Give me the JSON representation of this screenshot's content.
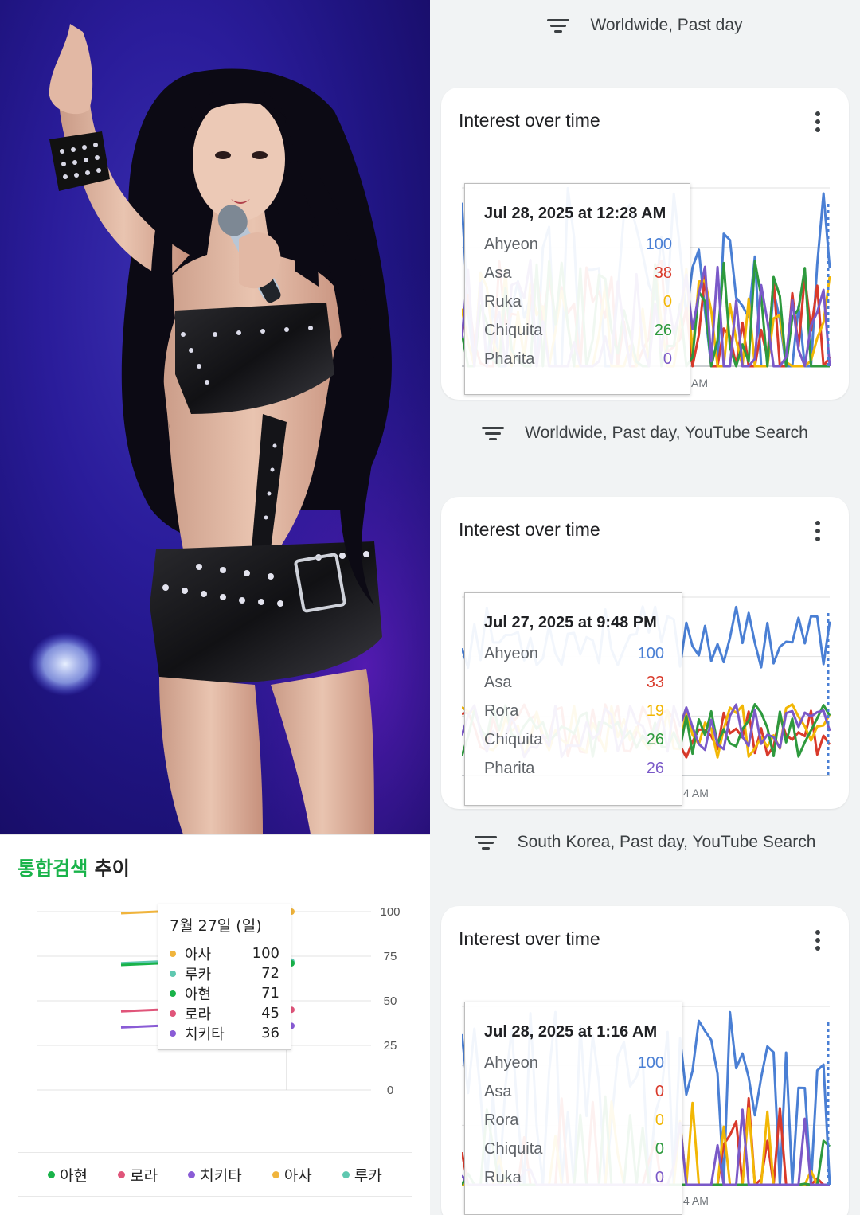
{
  "photo": {
    "description_icon": "performer-photo"
  },
  "korean_chart": {
    "title_green": "통합검색",
    "title_rest": " 추이",
    "y_ticks": [
      "100",
      "75",
      "50",
      "25",
      "0"
    ],
    "tooltip": {
      "date": "7월 27일 (일)",
      "rows": [
        {
          "name": "아사",
          "value": "100",
          "color": "#f0b43c"
        },
        {
          "name": "루카",
          "value": "72",
          "color": "#5fc8b0"
        },
        {
          "name": "아현",
          "value": "71",
          "color": "#19b34a"
        },
        {
          "name": "로라",
          "value": "45",
          "color": "#e0557a"
        },
        {
          "name": "치키타",
          "value": "36",
          "color": "#8a5cd6"
        }
      ]
    },
    "legend": [
      {
        "name": "아현",
        "color": "#19b34a"
      },
      {
        "name": "로라",
        "color": "#e0557a"
      },
      {
        "name": "치키타",
        "color": "#8a5cd6"
      },
      {
        "name": "아사",
        "color": "#f0b43c"
      },
      {
        "name": "루카",
        "color": "#5fc8b0"
      }
    ]
  },
  "chart_data": [
    {
      "type": "line",
      "title": "통합검색 추이",
      "series": [
        {
          "name": "아사",
          "values": [
            100
          ]
        },
        {
          "name": "루카",
          "values": [
            72
          ]
        },
        {
          "name": "아현",
          "values": [
            71
          ]
        },
        {
          "name": "로라",
          "values": [
            45
          ]
        },
        {
          "name": "치키타",
          "values": [
            36
          ]
        }
      ],
      "ylim": [
        0,
        100
      ]
    },
    {
      "type": "line",
      "title": "Interest over time",
      "series": [
        {
          "name": "Ahyeon",
          "values": [
            100
          ]
        },
        {
          "name": "Asa",
          "values": [
            38
          ]
        },
        {
          "name": "Ruka",
          "values": [
            0
          ]
        },
        {
          "name": "Chiquita",
          "values": [
            26
          ]
        },
        {
          "name": "Pharita",
          "values": [
            0
          ]
        }
      ]
    },
    {
      "type": "line",
      "title": "Interest over time",
      "series": [
        {
          "name": "Ahyeon",
          "values": [
            100
          ]
        },
        {
          "name": "Asa",
          "values": [
            33
          ]
        },
        {
          "name": "Rora",
          "values": [
            19
          ]
        },
        {
          "name": "Chiquita",
          "values": [
            26
          ]
        },
        {
          "name": "Pharita",
          "values": [
            26
          ]
        }
      ]
    },
    {
      "type": "line",
      "title": "Interest over time",
      "series": [
        {
          "name": "Ahyeon",
          "values": [
            100
          ]
        },
        {
          "name": "Asa",
          "values": [
            0
          ]
        },
        {
          "name": "Rora",
          "values": [
            0
          ]
        },
        {
          "name": "Chiquita",
          "values": [
            0
          ]
        },
        {
          "name": "Ruka",
          "values": [
            0
          ]
        }
      ]
    }
  ],
  "trends": [
    {
      "filter": "Worldwide, Past day",
      "card_title": "Interest over time",
      "axis_label": "AM",
      "tooltip": {
        "date": "Jul 28, 2025 at 12:28 AM",
        "rows": [
          {
            "name": "Ahyeon",
            "value": "100",
            "color": "#4a7fd4"
          },
          {
            "name": "Asa",
            "value": "38",
            "color": "#d93a2b"
          },
          {
            "name": "Ruka",
            "value": "0",
            "color": "#f2b705"
          },
          {
            "name": "Chiquita",
            "value": "26",
            "color": "#2e9a3e"
          },
          {
            "name": "Pharita",
            "value": "0",
            "color": "#7a59c8"
          }
        ]
      }
    },
    {
      "filter": "Worldwide, Past day, YouTube Search",
      "card_title": "Interest over time",
      "axis_label": "4 AM",
      "tooltip": {
        "date": "Jul 27, 2025 at 9:48 PM",
        "rows": [
          {
            "name": "Ahyeon",
            "value": "100",
            "color": "#4a7fd4"
          },
          {
            "name": "Asa",
            "value": "33",
            "color": "#d93a2b"
          },
          {
            "name": "Rora",
            "value": "19",
            "color": "#f2b705"
          },
          {
            "name": "Chiquita",
            "value": "26",
            "color": "#2e9a3e"
          },
          {
            "name": "Pharita",
            "value": "26",
            "color": "#7a59c8"
          }
        ]
      }
    },
    {
      "filter": "South Korea, Past day, YouTube Search",
      "card_title": "Interest over time",
      "axis_label": "4 AM",
      "tooltip": {
        "date": "Jul 28, 2025 at 1:16 AM",
        "rows": [
          {
            "name": "Ahyeon",
            "value": "100",
            "color": "#4a7fd4"
          },
          {
            "name": "Asa",
            "value": "0",
            "color": "#d93a2b"
          },
          {
            "name": "Rora",
            "value": "0",
            "color": "#f2b705"
          },
          {
            "name": "Chiquita",
            "value": "0",
            "color": "#2e9a3e"
          },
          {
            "name": "Ruka",
            "value": "0",
            "color": "#7a59c8"
          }
        ]
      }
    }
  ]
}
